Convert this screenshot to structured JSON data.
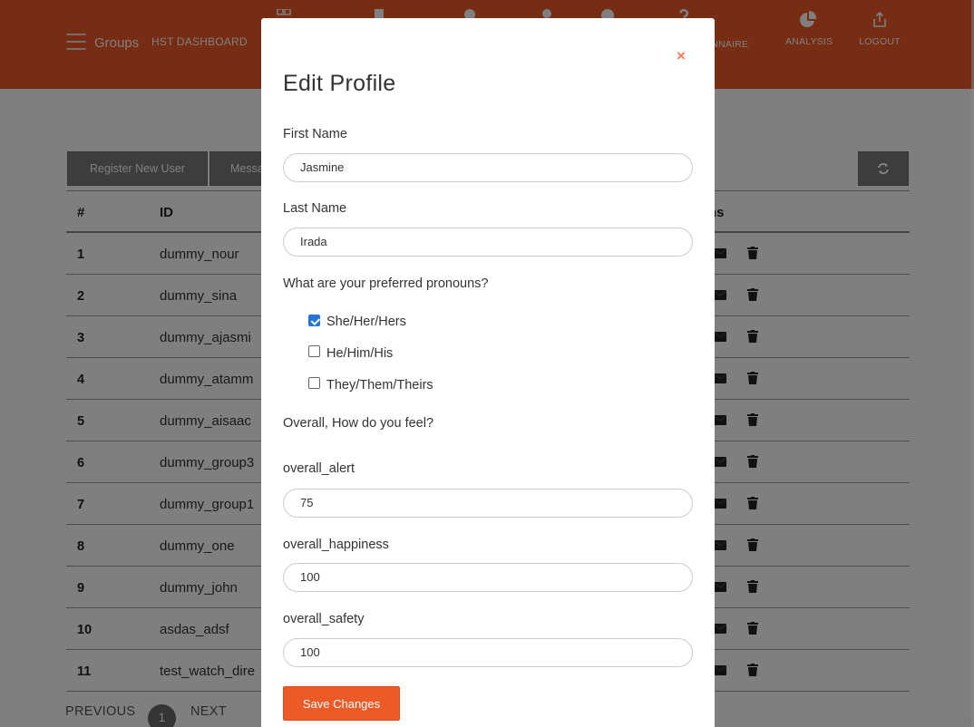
{
  "header": {
    "brand": "Groups",
    "dashboard": "HST DASHBOARD",
    "nav": [
      {
        "label": "ONNAIRE",
        "icon": "questionnaire-icon"
      },
      {
        "label": "ANALYSIS",
        "icon": "pie-chart-icon"
      },
      {
        "label": "LOGOUT",
        "icon": "share-icon"
      }
    ],
    "accent_color": "#ec5a28"
  },
  "toolbar": {
    "register_label": "Register New User",
    "message_label": "Messa"
  },
  "table": {
    "columns": [
      "#",
      "ID",
      "ns"
    ],
    "rows": [
      {
        "num": "1",
        "id": "dummy_nour"
      },
      {
        "num": "2",
        "id": "dummy_sina"
      },
      {
        "num": "3",
        "id": "dummy_ajasmi"
      },
      {
        "num": "4",
        "id": "dummy_atamm"
      },
      {
        "num": "5",
        "id": "dummy_aisaac"
      },
      {
        "num": "6",
        "id": "dummy_group3"
      },
      {
        "num": "7",
        "id": "dummy_group1"
      },
      {
        "num": "8",
        "id": "dummy_one"
      },
      {
        "num": "9",
        "id": "dummy_john"
      },
      {
        "num": "10",
        "id": "asdas_adsf"
      },
      {
        "num": "11",
        "id": "test_watch_dire"
      }
    ]
  },
  "pagination": {
    "previous": "PREVIOUS",
    "current": "1",
    "next": "NEXT"
  },
  "modal": {
    "close": "×",
    "title": "Edit Profile",
    "first_name_label": "First Name",
    "first_name_value": "Jasmine",
    "last_name_label": "Last Name",
    "last_name_value": "Irada",
    "pronouns_question": "What are your preferred pronouns?",
    "pronouns": [
      {
        "label": "She/Her/Hers",
        "checked": true
      },
      {
        "label": "He/Him/His",
        "checked": false
      },
      {
        "label": "They/Them/Theirs",
        "checked": false
      }
    ],
    "feel_question": "Overall, How do you feel?",
    "alert_label": "overall_alert",
    "alert_value": "75",
    "happiness_label": "overall_happiness",
    "happiness_value": "100",
    "safety_label": "overall_safety",
    "safety_value": "100",
    "save_label": "Save Changes"
  }
}
